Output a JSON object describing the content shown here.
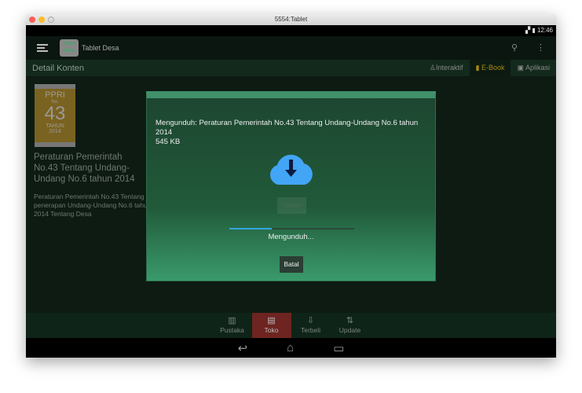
{
  "window": {
    "title": "5554:Tablet"
  },
  "status_bar": {
    "time": "12:46"
  },
  "app_bar": {
    "logo_text": "Tablet Desa",
    "title": "Tablet Desa"
  },
  "subheader": {
    "title": "Detail Konten",
    "tabs": [
      {
        "label": "Interaktif",
        "icon": "person-icon"
      },
      {
        "label": "E-Book",
        "icon": "book-icon",
        "active": true
      },
      {
        "label": "Aplikasi",
        "icon": "phone-icon"
      }
    ]
  },
  "book": {
    "cover": {
      "line1": "PPRI",
      "line2": "No.",
      "line3": "43",
      "line4": "TAHUN",
      "line5": "2014"
    },
    "title": "Peraturan Pemerintah No.43 Tentang Undang-Undang No.6 tahun 2014",
    "description": "Peraturan Pemerintah No.43 Tentang penerapan Undang-Undang No.6 tahun 2014 Tentang Desa"
  },
  "dialog": {
    "message": "Mengunduh: Peraturan Pemerintah No.43 Tentang Undang-Undang No.6 tahun 2014",
    "size": "545 KB",
    "download_button": "Unduh",
    "progress": 0.34,
    "progress_label": "Mengunduh...",
    "cancel_button": "Batal",
    "colors": {
      "cloud": "#42a5f5",
      "progress": "#33a5e0"
    }
  },
  "bottom_nav": [
    {
      "label": "Pustaka",
      "icon": "book-open-icon"
    },
    {
      "label": "Toko",
      "icon": "store-icon",
      "active": true
    },
    {
      "label": "Terbeli",
      "icon": "download-tray-icon"
    },
    {
      "label": "Update",
      "icon": "update-icon"
    }
  ]
}
